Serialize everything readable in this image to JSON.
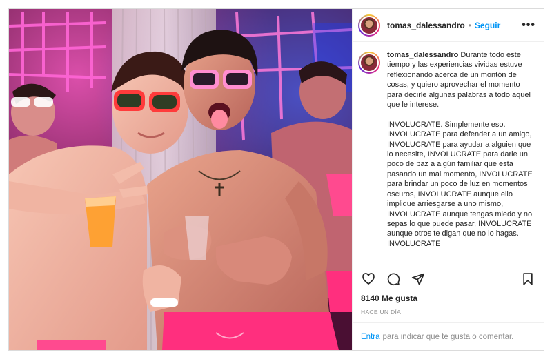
{
  "post": {
    "username": "tomas_dalessandro",
    "dot": "•",
    "follow_label": "Seguir",
    "more_icon": "more-options-icon",
    "caption": "Durante todo este tiempo y las experiencias vividas estuve reflexionando acerca de un montón de cosas, y quiero aprovechar el momento para decirle algunas palabras a todo aquel que le interese.\n\nINVOLUCRATE. Simplemente eso. INVOLUCRATE para defender a un amigo, INVOLUCRATE para ayudar a alguien que lo necesite, INVOLUCRATE para darle un poco de paz a algún familiar que esta pasando un mal momento, INVOLUCRATE para brindar un poco de luz en momentos oscuros, INVOLUCRATE aunque ello implique arriesgarse a uno mismo, INVOLUCRATE aunque tengas miedo y no sepas lo que puede pasar, INVOLUCRATE aunque otros te digan que no lo hagas. INVOLUCRATE",
    "likes": "8140 Me gusta",
    "time": "HACE UN DÍA"
  },
  "actions": {
    "like": "heart-icon",
    "comment": "comment-icon",
    "share": "share-icon",
    "save": "bookmark-icon"
  },
  "comment_bar": {
    "login_label": "Entra",
    "prompt": "para indicar que te gusta o comentar."
  },
  "colors": {
    "link": "#0095f6",
    "text": "#262626",
    "muted": "#8e8e8e",
    "neon_pink": "#ff3d9a",
    "shorts_pink": "#ff2f7e"
  }
}
